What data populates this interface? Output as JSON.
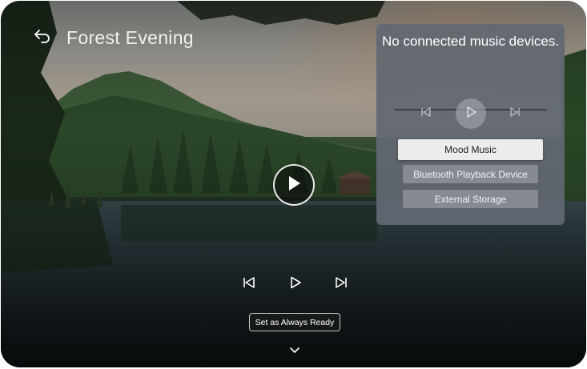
{
  "header": {
    "title": "Forest Evening"
  },
  "player": {
    "ready_label": "Set as Always Ready"
  },
  "music_panel": {
    "message": "No connected music devices.",
    "options": [
      {
        "label": "Mood Music",
        "selected": true
      },
      {
        "label": "Bluetooth Playback Device",
        "selected": false
      },
      {
        "label": "External Storage",
        "selected": false
      }
    ]
  },
  "icons": {
    "back": "back-arrow-icon",
    "play": "play-icon",
    "previous": "skip-previous-icon",
    "next": "skip-next-icon",
    "expand": "chevron-down-icon"
  },
  "colors": {
    "panel_bg": "#626872",
    "selected_option_bg": "#ececec",
    "option_bg": "#8c919a"
  }
}
